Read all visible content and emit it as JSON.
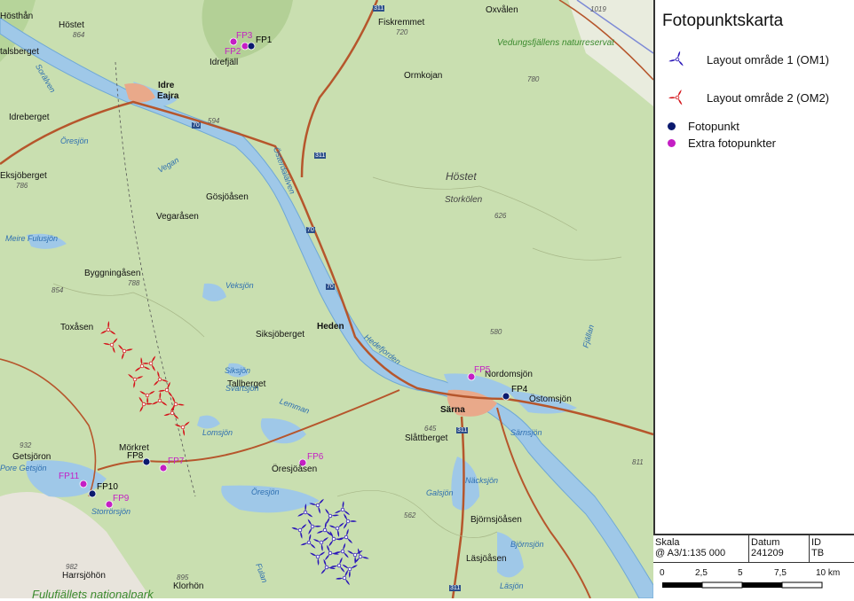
{
  "map": {
    "places": {
      "hosthan": "Hösthån",
      "hostet_n": "Höstet",
      "talsberget": "talsberget",
      "idrefjall": "Idrefjäll",
      "idre": "Idre",
      "eajra": "Eajra",
      "fiskremmet": "Fiskremmet",
      "ormkojan": "Ormkojan",
      "oxvalen": "Oxvålen",
      "idreberget": "Idreberget",
      "eksjoberget": "Eksjöberget",
      "gosjoasen": "Gösjöåsen",
      "vegarasen": "Vegaråsen",
      "byggningasen": "Byggningåsen",
      "toxasen": "Toxåsen",
      "siksjoberget": "Siksjöberget",
      "tallberget": "Tallberget",
      "heden": "Heden",
      "hostet": "Höstet",
      "storkolen": "Storkölen",
      "nordomsjon": "Nordomsjön",
      "ostomsjon": "Östomsjön",
      "sarna": "Särna",
      "slattberget": "Slåttberget",
      "orsjoasen": "Öresjöåsen",
      "morkret": "Mörkret",
      "getsjoron": "Getsjöron",
      "bjornsjoasen": "Björnsjöåsen",
      "lasjoasen": "Läsjöåsen",
      "harrsjohon": "Harrsjöhön",
      "klorhon": "Klorhön",
      "harrsjohon2": "Harrsjöhön"
    },
    "lakes": {
      "oresjon_n": "Öresjön",
      "vegan": "Vegan",
      "fulusjon": "Meire Fulusjön",
      "veksjon": "Veksjön",
      "siksjon": "Siksjön",
      "svartsjon": "Svartsjön",
      "lemman": "Lemman",
      "lomsjon": "Lomsjön",
      "oresjon_s": "Öresjön",
      "galsjon": "Galsjön",
      "nacksjon": "Näcksjön",
      "samsjon": "Särnsjön",
      "bjornsjon": "Björnsjön",
      "lasjon": "Läsjön",
      "storrorsjon": "Storrörsjön",
      "getsjon": "Pore Getsjön",
      "osterdal": "Österdalälven",
      "hedefors": "Hedefjorden",
      "fjallan": "Fjällan",
      "fulan": "Fulan",
      "sorsjo": "Sorälven"
    },
    "reserves": {
      "vedungs": "Vedungsfjällens naturreservat",
      "fulufjall": "Fulufjällets nationalpark"
    },
    "elevations": [
      "864",
      "720",
      "780",
      "594",
      "786",
      "788",
      "854",
      "626",
      "580",
      "932",
      "811",
      "645",
      "562",
      "982",
      "1019",
      "895"
    ],
    "roads": {
      "r311": "311",
      "r70": "70"
    },
    "fotopunkter": [
      "FP1",
      "FP4",
      "FP8",
      "FP10"
    ],
    "extra_fotopunkter": [
      "FP2",
      "FP3",
      "FP5",
      "FP6",
      "FP7",
      "FP9",
      "FP11"
    ],
    "turbine_counts": {
      "om1": 22,
      "om2": 14
    }
  },
  "legend": {
    "title": "Fotopunktskarta",
    "om1": "Layout område 1 (OM1)",
    "om2": "Layout område 2 (OM2)",
    "fotopunkt": "Fotopunkt",
    "extra": "Extra fotopunkter",
    "colors": {
      "om1": "#2a16b8",
      "om2": "#d4141a",
      "fotopunkt": "#0b1a6e",
      "extra": "#c41fc4"
    }
  },
  "info": {
    "skala_label": "Skala",
    "skala_value": "@ A3/1:135 000",
    "datum_label": "Datum",
    "datum_value": "241209",
    "id_label": "ID",
    "id_value": "TB"
  },
  "scalebar": {
    "ticks": [
      "0",
      "2,5",
      "5",
      "7,5",
      "10 km"
    ]
  }
}
